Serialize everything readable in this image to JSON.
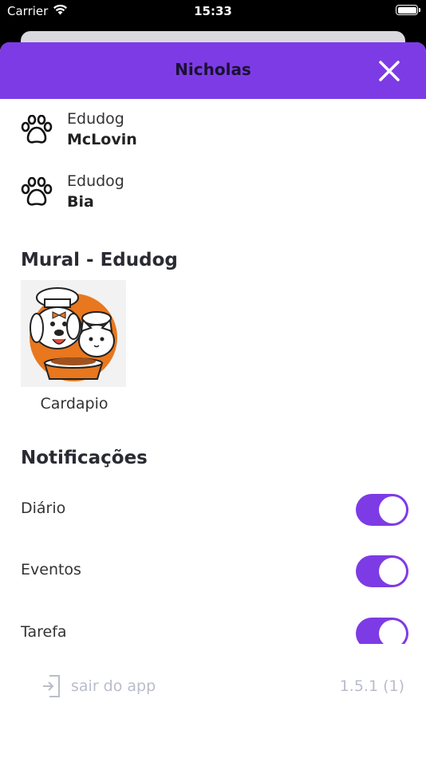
{
  "status_bar": {
    "carrier": "Carrier",
    "time": "15:33"
  },
  "header": {
    "title": "Nicholas"
  },
  "pets": [
    {
      "school": "Edudog",
      "name": "McLovin"
    },
    {
      "school": "Edudog",
      "name": "Bia"
    }
  ],
  "mural": {
    "title": "Mural - Edudog",
    "items": [
      {
        "caption": "Cardapio",
        "icon": "dog-cat-chef-illustration"
      }
    ]
  },
  "notifications": {
    "title": "Notificações",
    "items": [
      {
        "label": "Diário",
        "enabled": true
      },
      {
        "label": "Eventos",
        "enabled": true
      },
      {
        "label": "Tarefa",
        "enabled": true
      }
    ]
  },
  "footer": {
    "logout_label": "sair do app",
    "version": "1.5.1 (1)"
  },
  "colors": {
    "accent": "#7d3be6",
    "muted_text": "#b9bdc9"
  }
}
